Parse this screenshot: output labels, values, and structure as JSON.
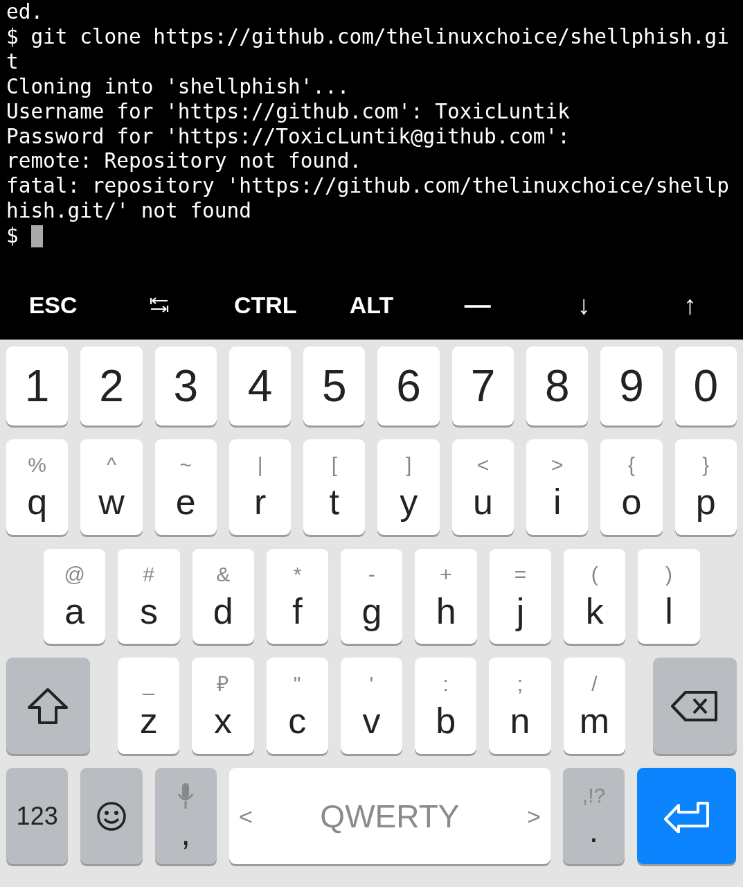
{
  "terminal": {
    "lines": [
      "ed.",
      "$ git clone https://github.com/thelinuxchoice/shellphish.gi",
      "t",
      "Cloning into 'shellphish'...",
      "Username for 'https://github.com': ToxicLuntik",
      "Password for 'https://ToxicLuntik@github.com':",
      "remote: Repository not found.",
      "fatal: repository 'https://github.com/thelinuxchoice/shellp",
      "hish.git/' not found"
    ],
    "prompt": "$"
  },
  "extra_keys": [
    {
      "kind": "text",
      "label": "ESC"
    },
    {
      "kind": "tab"
    },
    {
      "kind": "text",
      "label": "CTRL"
    },
    {
      "kind": "text",
      "label": "ALT"
    },
    {
      "kind": "text",
      "label": "—"
    },
    {
      "kind": "text",
      "label": "↓"
    },
    {
      "kind": "text",
      "label": "↑"
    }
  ],
  "keyboard": {
    "rows": [
      [
        {
          "kind": "digit",
          "main": "1"
        },
        {
          "kind": "digit",
          "main": "2"
        },
        {
          "kind": "digit",
          "main": "3"
        },
        {
          "kind": "digit",
          "main": "4"
        },
        {
          "kind": "digit",
          "main": "5"
        },
        {
          "kind": "digit",
          "main": "6"
        },
        {
          "kind": "digit",
          "main": "7"
        },
        {
          "kind": "digit",
          "main": "8"
        },
        {
          "kind": "digit",
          "main": "9"
        },
        {
          "kind": "digit",
          "main": "0"
        }
      ],
      [
        {
          "kind": "letter",
          "main": "q",
          "hint": "%"
        },
        {
          "kind": "letter",
          "main": "w",
          "hint": "^"
        },
        {
          "kind": "letter",
          "main": "e",
          "hint": "~"
        },
        {
          "kind": "letter",
          "main": "r",
          "hint": "|"
        },
        {
          "kind": "letter",
          "main": "t",
          "hint": "["
        },
        {
          "kind": "letter",
          "main": "y",
          "hint": "]"
        },
        {
          "kind": "letter",
          "main": "u",
          "hint": "<"
        },
        {
          "kind": "letter",
          "main": "i",
          "hint": ">"
        },
        {
          "kind": "letter",
          "main": "o",
          "hint": "{"
        },
        {
          "kind": "letter",
          "main": "p",
          "hint": "}"
        }
      ],
      [
        {
          "kind": "letter",
          "main": "a",
          "hint": "@"
        },
        {
          "kind": "letter",
          "main": "s",
          "hint": "#"
        },
        {
          "kind": "letter",
          "main": "d",
          "hint": "&"
        },
        {
          "kind": "letter",
          "main": "f",
          "hint": "*"
        },
        {
          "kind": "letter",
          "main": "g",
          "hint": "-"
        },
        {
          "kind": "letter",
          "main": "h",
          "hint": "+"
        },
        {
          "kind": "letter",
          "main": "j",
          "hint": "="
        },
        {
          "kind": "letter",
          "main": "k",
          "hint": "("
        },
        {
          "kind": "letter",
          "main": "l",
          "hint": ")"
        }
      ],
      [
        {
          "kind": "shift"
        },
        {
          "kind": "letter",
          "main": "z",
          "hint": "_"
        },
        {
          "kind": "letter",
          "main": "x",
          "hint": "₽"
        },
        {
          "kind": "letter",
          "main": "c",
          "hint": "\""
        },
        {
          "kind": "letter",
          "main": "v",
          "hint": "'"
        },
        {
          "kind": "letter",
          "main": "b",
          "hint": ":"
        },
        {
          "kind": "letter",
          "main": "n",
          "hint": ";"
        },
        {
          "kind": "letter",
          "main": "m",
          "hint": "/"
        },
        {
          "kind": "backspace"
        }
      ],
      [
        {
          "kind": "symbols",
          "main": "123"
        },
        {
          "kind": "emoji"
        },
        {
          "kind": "mic",
          "main": ","
        },
        {
          "kind": "space",
          "main": "QWERTY",
          "left": "<",
          "right": ">"
        },
        {
          "kind": "punct",
          "main": ".",
          "hint": ",!?"
        },
        {
          "kind": "enter"
        }
      ]
    ]
  }
}
